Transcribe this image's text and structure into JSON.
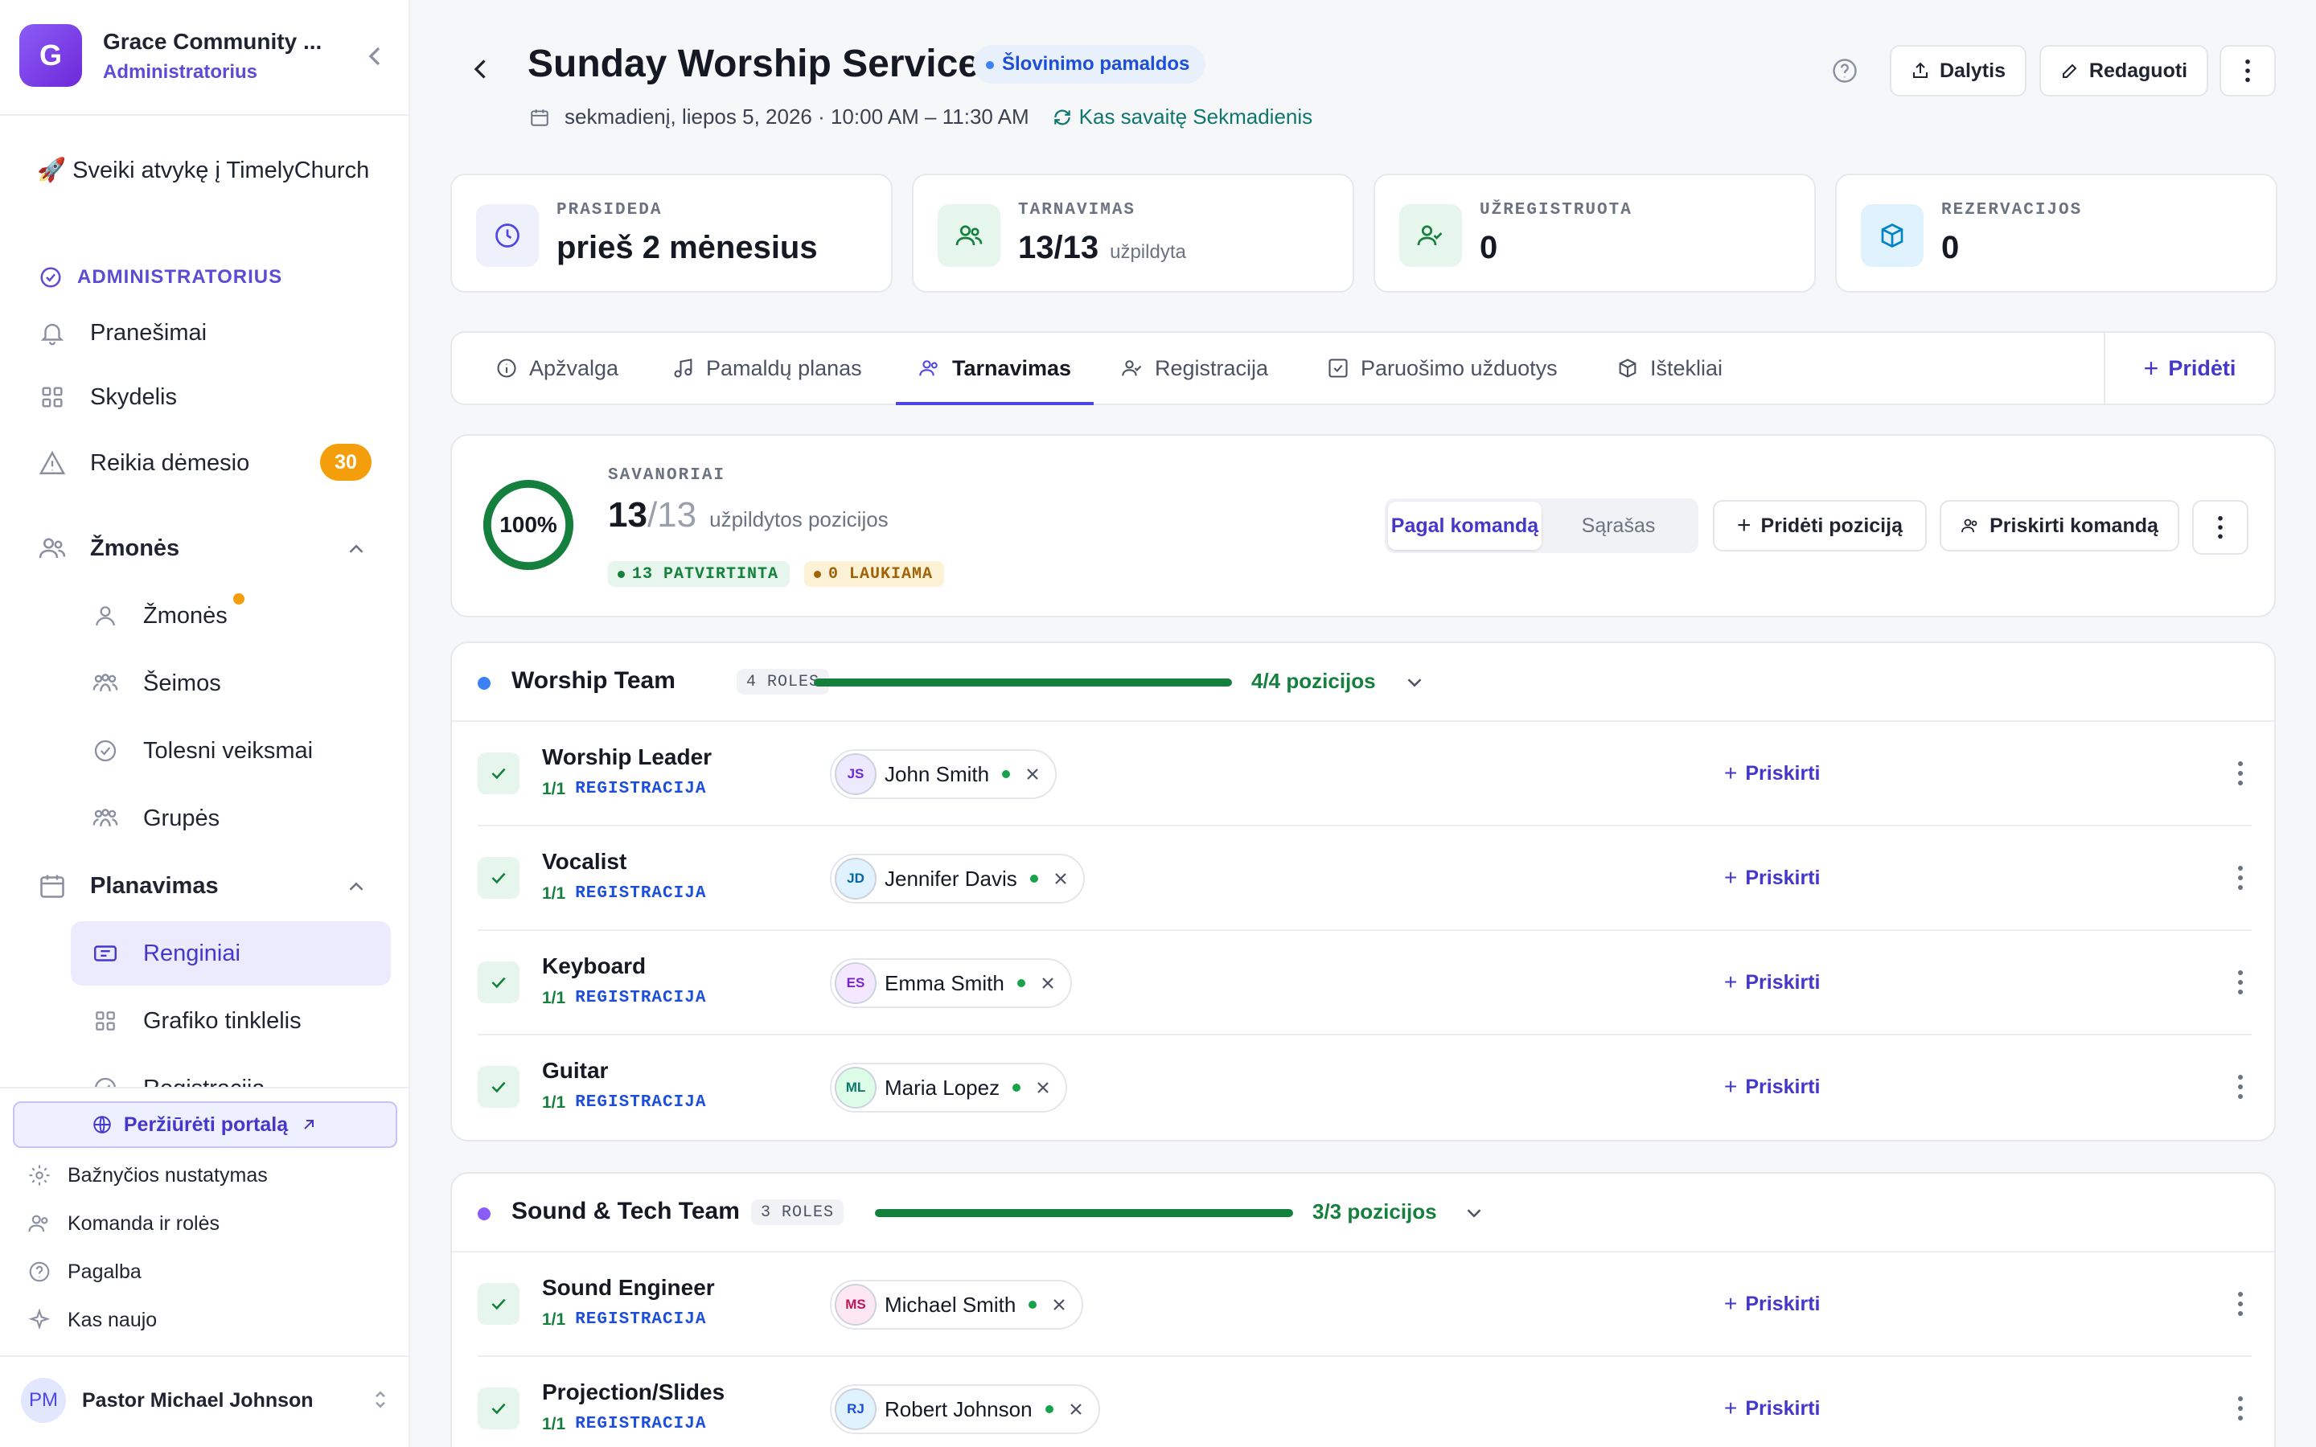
{
  "sidebar": {
    "org_logo_letter": "G",
    "org_name": "Grace Community ...",
    "org_role": "Administratorius",
    "welcome": "🚀 Sveiki atvykę į TimelyChurch",
    "section_admin": "ADMINISTRATORIUS",
    "items": [
      {
        "label": "Pranešimai",
        "icon": "bell-icon"
      },
      {
        "label": "Skydelis",
        "icon": "grid-icon"
      },
      {
        "label": "Reikia dėmesio",
        "icon": "warning-icon",
        "badge": "30"
      },
      {
        "label": "Žmonės",
        "icon": "people-icon"
      },
      {
        "label": "Žmonės",
        "icon": "person-icon"
      },
      {
        "label": "Šeimos",
        "icon": "family-icon"
      },
      {
        "label": "Tolesni veiksmai",
        "icon": "check-circle-icon"
      },
      {
        "label": "Grupės",
        "icon": "groups-icon"
      },
      {
        "label": "Planavimas",
        "icon": "calendar-icon"
      },
      {
        "label": "Renginiai",
        "icon": "ticket-icon"
      },
      {
        "label": "Grafiko tinklelis",
        "icon": "grid-icon"
      },
      {
        "label": "Registracija",
        "icon": "check-circle-icon"
      }
    ],
    "portal": "Peržiūrėti portalą",
    "footer": [
      {
        "label": "Bažnyčios nustatymas",
        "icon": "gear-icon"
      },
      {
        "label": "Komanda ir rolės",
        "icon": "people-icon"
      },
      {
        "label": "Pagalba",
        "icon": "help-icon"
      },
      {
        "label": "Kas naujo",
        "icon": "sparkle-icon"
      }
    ],
    "user_initials": "PM",
    "user_name": "Pastor Michael Johnson"
  },
  "header": {
    "title": "Sunday Worship Service",
    "type": "Šlovinimo pamaldos",
    "date": "sekmadienį, liepos 5, 2026 · 10:00 AM – 11:30 AM",
    "recurrence": "Kas savaitę Sekmadienis",
    "share": "Dalytis",
    "edit": "Redaguoti"
  },
  "stats": [
    {
      "label": "PRASIDEDA",
      "value": "prieš 2 mėnesius",
      "suffix": "",
      "color": "#4f46e5"
    },
    {
      "label": "TARNAVIMAS",
      "value": "13/13",
      "suffix": "užpildyta",
      "color": "#15803d"
    },
    {
      "label": "UŽREGISTRUOTA",
      "value": "0",
      "suffix": "",
      "color": "#15803d"
    },
    {
      "label": "REZERVACIJOS",
      "value": "0",
      "suffix": "",
      "color": "#0284c7"
    }
  ],
  "tabs": [
    "Apžvalga",
    "Pamaldų planas",
    "Tarnavimas",
    "Registracija",
    "Paruošimo užduotys",
    "Ištekliai"
  ],
  "active_tab": "Tarnavimas",
  "tab_add": "Pridėti",
  "volunteers": {
    "progress_text": "100%",
    "progress": 1.0,
    "label": "SAVANORIAI",
    "filled": "13",
    "total": "/13",
    "caption": "užpildytos pozicijos",
    "confirmed": "13 PATVIRTINTA",
    "pending": "0 LAUKIAMA",
    "view_team": "Pagal komandą",
    "view_list": "Sąrašas",
    "add_position": "Pridėti poziciją",
    "assign_team": "Priskirti komandą"
  },
  "teams": [
    {
      "name": "Worship Team",
      "roles": "4 ROLES",
      "positions": "4/4 pozicijos",
      "color": "#3b82f6",
      "fill": 1.0,
      "rows": [
        {
          "role": "Worship Leader",
          "count": "1/1",
          "reg": "REGISTRACIJA",
          "initials": "JS",
          "person": "John Smith",
          "avbg": "#ede9fe",
          "avfg": "#6d28d9"
        },
        {
          "role": "Vocalist",
          "count": "1/1",
          "reg": "REGISTRACIJA",
          "initials": "JD",
          "person": "Jennifer Davis",
          "avbg": "#e0f2fe",
          "avfg": "#0369a1"
        },
        {
          "role": "Keyboard",
          "count": "1/1",
          "reg": "REGISTRACIJA",
          "initials": "ES",
          "person": "Emma Smith",
          "avbg": "#f3e8ff",
          "avfg": "#7e22ce"
        },
        {
          "role": "Guitar",
          "count": "1/1",
          "reg": "REGISTRACIJA",
          "initials": "ML",
          "person": "Maria Lopez",
          "avbg": "#dcfce7",
          "avfg": "#0f766e"
        }
      ]
    },
    {
      "name": "Sound & Tech Team",
      "roles": "3 ROLES",
      "positions": "3/3 pozicijos",
      "color": "#8b5cf6",
      "fill": 1.0,
      "rows": [
        {
          "role": "Sound Engineer",
          "count": "1/1",
          "reg": "REGISTRACIJA",
          "initials": "MS",
          "person": "Michael Smith",
          "avbg": "#fce7f3",
          "avfg": "#be185d"
        },
        {
          "role": "Projection/Slides",
          "count": "1/1",
          "reg": "REGISTRACIJA",
          "initials": "RJ",
          "person": "Robert Johnson",
          "avbg": "#e0f2fe",
          "avfg": "#1d4ed8"
        }
      ]
    }
  ],
  "assign_label": "Priskirti"
}
